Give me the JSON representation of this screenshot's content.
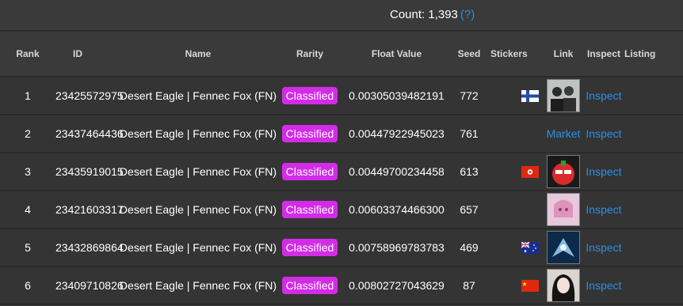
{
  "count": {
    "label": "Count: 1,393",
    "help": "(?)"
  },
  "columns": {
    "rank": "Rank",
    "id": "ID",
    "name": "Name",
    "rarity": "Rarity",
    "float": "Float Value",
    "seed": "Seed",
    "stickers": "Stickers",
    "link": "Link",
    "inspect": "Inspect",
    "listing": "Listing"
  },
  "colors": {
    "accent": "#2b8ee6",
    "classified": "#d32ce6"
  },
  "rows": [
    {
      "rank": "1",
      "id": "23425572975",
      "name": "Desert Eagle | Fennec Fox (FN)",
      "rarity": "Classified",
      "float": "0.00305039482191",
      "seed": "772",
      "flag": "flag-finland",
      "link": "avatar-image",
      "inspect": "Inspect"
    },
    {
      "rank": "2",
      "id": "23437464436",
      "name": "Desert Eagle | Fennec Fox (FN)",
      "rarity": "Classified",
      "float": "0.00447922945023",
      "seed": "761",
      "flag": "",
      "link": "Market",
      "inspect": "Inspect"
    },
    {
      "rank": "3",
      "id": "23435919015",
      "name": "Desert Eagle | Fennec Fox (FN)",
      "rarity": "Classified",
      "float": "0.00449700234458",
      "seed": "613",
      "flag": "flag-hong-kong",
      "link": "avatar-image",
      "inspect": "Inspect"
    },
    {
      "rank": "4",
      "id": "23421603317",
      "name": "Desert Eagle | Fennec Fox (FN)",
      "rarity": "Classified",
      "float": "0.00603374466300",
      "seed": "657",
      "flag": "",
      "link": "avatar-image",
      "inspect": "Inspect"
    },
    {
      "rank": "5",
      "id": "23432869864",
      "name": "Desert Eagle | Fennec Fox (FN)",
      "rarity": "Classified",
      "float": "0.00758969783783",
      "seed": "469",
      "flag": "flag-australia",
      "link": "avatar-image",
      "inspect": "Inspect"
    },
    {
      "rank": "6",
      "id": "23409710826",
      "name": "Desert Eagle | Fennec Fox (FN)",
      "rarity": "Classified",
      "float": "0.00802727043629",
      "seed": "87",
      "flag": "flag-china",
      "link": "avatar-image",
      "inspect": "Inspect"
    }
  ]
}
